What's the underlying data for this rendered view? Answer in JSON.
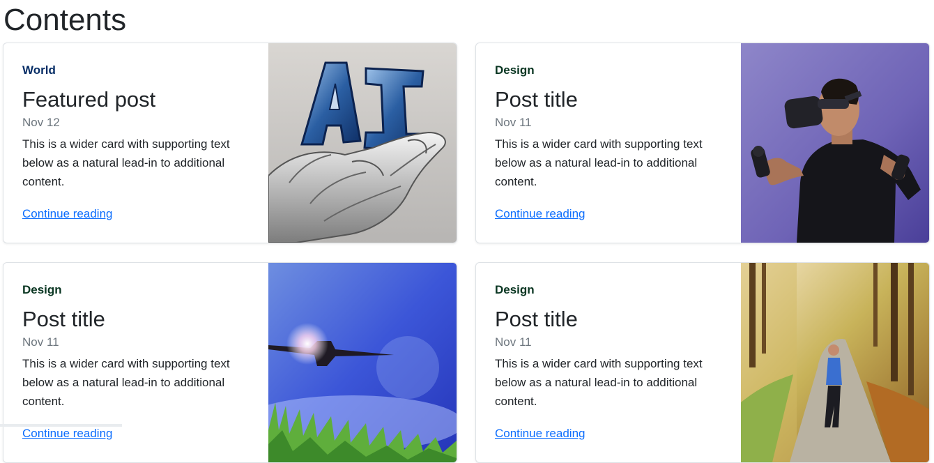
{
  "page": {
    "title": "Contents"
  },
  "colors": {
    "category_world": "#052c65",
    "category_design": "#0a3622",
    "link": "#0d6efd"
  },
  "cards": [
    {
      "category": "World",
      "title": "Featured post",
      "date": "Nov 12",
      "text": "This is a wider card with supporting text below as a natural lead-in to additional content.",
      "link": "Continue reading",
      "thumbnail": "ai-robot-hand"
    },
    {
      "category": "Design",
      "title": "Post title",
      "date": "Nov 11",
      "text": "This is a wider card with supporting text below as a natural lead-in to additional content.",
      "link": "Continue reading",
      "thumbnail": "vr-headset-man"
    },
    {
      "category": "Design",
      "title": "Post title",
      "date": "Nov 11",
      "text": "This is a wider card with supporting text below as a natural lead-in to additional content.",
      "link": "Continue reading",
      "thumbnail": "airplane-sky"
    },
    {
      "category": "Design",
      "title": "Post title",
      "date": "Nov 11",
      "text": "This is a wider card with supporting text below as a natural lead-in to additional content.",
      "link": "Continue reading",
      "thumbnail": "autumn-runner"
    }
  ]
}
